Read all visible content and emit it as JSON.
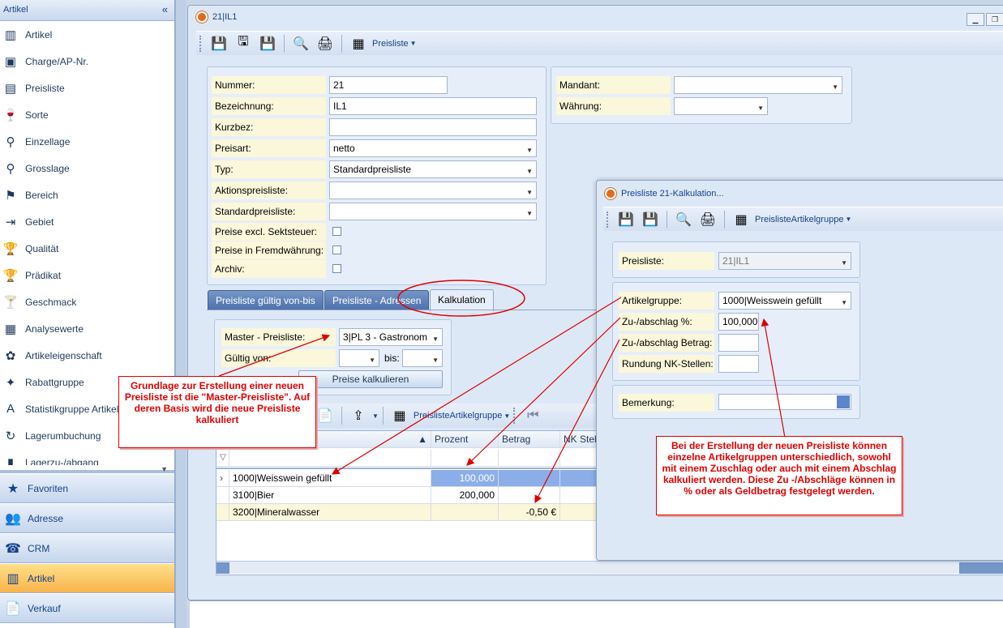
{
  "nav": {
    "header": "Artikel",
    "collapse_glyph": "«",
    "items": [
      {
        "label": "Artikel",
        "icon": "barcode-icon",
        "glyph": "▥"
      },
      {
        "label": "Charge/AP-Nr.",
        "icon": "bottle-label-icon",
        "glyph": "▣"
      },
      {
        "label": "Preisliste",
        "icon": "pricelist-icon",
        "glyph": "▤"
      },
      {
        "label": "Sorte",
        "icon": "wine-glass-icon",
        "glyph": "🍷"
      },
      {
        "label": "Einzellage",
        "icon": "magnifier-green-icon",
        "glyph": "⚲"
      },
      {
        "label": "Grosslage",
        "icon": "magnifier-icon",
        "glyph": "⚲"
      },
      {
        "label": "Bereich",
        "icon": "flag-green-icon",
        "glyph": "⚑"
      },
      {
        "label": "Gebiet",
        "icon": "signpost-icon",
        "glyph": "⇥"
      },
      {
        "label": "Qualität",
        "icon": "trophy-icon",
        "glyph": "🏆"
      },
      {
        "label": "Prädikat",
        "icon": "trophy-icon",
        "glyph": "🏆"
      },
      {
        "label": "Geschmack",
        "icon": "cocktail-icon",
        "glyph": "🍸"
      },
      {
        "label": "Analysewerte",
        "icon": "chart-doc-icon",
        "glyph": "▦"
      },
      {
        "label": "Artikeleigenschaft",
        "icon": "seal-icon",
        "glyph": "✿"
      },
      {
        "label": "Rabattgruppe",
        "icon": "person-icon",
        "glyph": "✦"
      },
      {
        "label": "Statistikgruppe Artikel",
        "icon": "abc-icon",
        "glyph": "A"
      },
      {
        "label": "Lagerumbuchung",
        "icon": "refresh-icon",
        "glyph": "↻"
      },
      {
        "label": "Lagerzu-/abgang",
        "icon": "stock-icon",
        "glyph": "▮"
      }
    ],
    "categories": [
      {
        "label": "Favoriten",
        "icon": "star-icon",
        "glyph": "★",
        "active": false
      },
      {
        "label": "Adresse",
        "icon": "people-icon",
        "glyph": "👥",
        "active": false
      },
      {
        "label": "CRM",
        "icon": "phone-icon",
        "glyph": "☎",
        "active": false
      },
      {
        "label": "Artikel",
        "icon": "barcode-icon",
        "glyph": "▥",
        "active": true
      },
      {
        "label": "Verkauf",
        "icon": "document-icon",
        "glyph": "📄",
        "active": false
      }
    ]
  },
  "main_window": {
    "title": "21|IL1",
    "toolbar_dropdown": "Preisliste",
    "form": {
      "nummer_label": "Nummer:",
      "nummer_value": "21",
      "bezeichnung_label": "Bezeichnung:",
      "bezeichnung_value": "IL1",
      "kurzbez_label": "Kurzbez:",
      "kurzbez_value": "",
      "preisart_label": "Preisart:",
      "preisart_value": "netto",
      "typ_label": "Typ:",
      "typ_value": "Standardpreisliste",
      "aktionspreisliste_label": "Aktionspreisliste:",
      "aktionspreisliste_value": "",
      "standardpreisliste_label": "Standardpreisliste:",
      "standardpreisliste_value": "",
      "sektsteuer_label": "Preise excl. Sektsteuer:",
      "fremdwaehrung_label": "Preise in Fremdwährung:",
      "archiv_label": "Archiv:",
      "mandant_label": "Mandant:",
      "mandant_value": "",
      "waehrung_label": "Währung:",
      "waehrung_value": ""
    },
    "tabs": [
      {
        "label": "Preisliste gültig von-bis",
        "active": false
      },
      {
        "label": "Preisliste - Adressen",
        "active": false
      },
      {
        "label": "Kalkulation",
        "active": true
      }
    ],
    "kalkulation": {
      "master_label": "Master - Preisliste:",
      "master_value": "3|PL 3 - Gastronom",
      "gueltig_label": "Gültig von:",
      "bis_label": "bis:",
      "calc_button": "Preise kalkulieren",
      "grid_toolbar_dropdown": "PreislisteArtikelgruppe",
      "columns": [
        "",
        "Prozent",
        "Betrag",
        "NK Stel"
      ],
      "rows": [
        {
          "name": "1000|Weisswein gefüllt",
          "prozent": "100,000",
          "betrag": ""
        },
        {
          "name": "3100|Bier",
          "prozent": "200,000",
          "betrag": ""
        },
        {
          "name": "3200|Mineralwasser",
          "prozent": "",
          "betrag": "-0,50 €"
        }
      ]
    }
  },
  "calc_window": {
    "title": "Preisliste 21-Kalkulation...",
    "toolbar_dropdown": "PreislisteArtikelgruppe",
    "preisliste_label": "Preisliste:",
    "preisliste_value": "21|IL1",
    "artikelgruppe_label": "Artikelgruppe:",
    "artikelgruppe_value": "1000|Weisswein gefüllt",
    "zuabschlag_pct_label": "Zu-/abschlag %:",
    "zuabschlag_pct_value": "100,000",
    "zuabschlag_betrag_label": "Zu-/abschlag Betrag:",
    "zuabschlag_betrag_value": "",
    "rundung_label": "Rundung NK-Stellen:",
    "rundung_value": "",
    "bemerkung_label": "Bemerkung:",
    "bemerkung_value": ""
  },
  "callouts": {
    "left": "Grundlage zur Erstellung einer neuen Preisliste ist die \"Master-Preisliste\". Auf deren Basis wird die neue Preisliste kalkuliert",
    "right": "Bei der Erstellung der neuen Preisliste können einzelne Artikelgruppen unterschiedlich, sowohl mit einem Zuschlag oder auch mit einem Abschlag kalkuliert werden. Diese Zu -/Abschläge können in % oder als Geldbetrag festgelegt werden."
  },
  "colors": {
    "annotation_red": "#dd0000",
    "selected_cell_blue": "#8caee8",
    "label_yellow": "#fbf7da",
    "active_nav_orange": "#f8b34b"
  }
}
